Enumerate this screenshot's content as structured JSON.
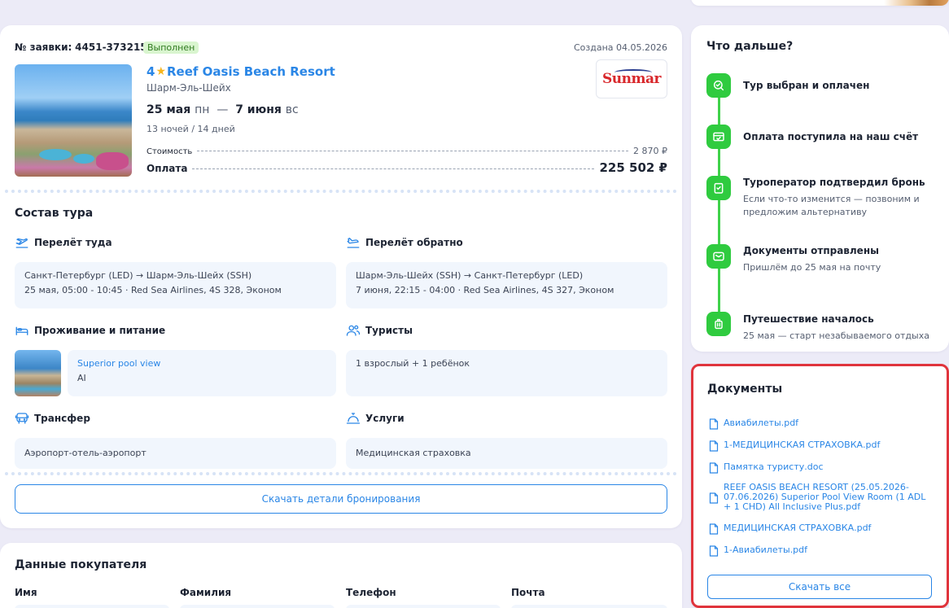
{
  "booking": {
    "order_label": "№ заявки:",
    "order_number": "4451-373215",
    "status": "Выполнен",
    "created": "Создана 04.05.2026",
    "hotel_stars": "4",
    "hotel_name": "Reef Oasis Beach Resort",
    "city": "Шарм-Эль-Шейх",
    "date_from": "25 мая",
    "dow_from": "пн",
    "dash": "—",
    "date_to": "7 июня",
    "dow_to": "вс",
    "nights": "13 ночей / 14 дней",
    "operator": "Sunmar",
    "cost_label": "Стоимость",
    "cost_value": "2 870 ₽",
    "pay_label": "Оплата",
    "pay_value": "225 502 ₽",
    "composition_title": "Состав тура",
    "flight_to": {
      "label": "Перелёт туда",
      "route": "Санкт-Петербург (LED) → Шарм-Эль-Шейх (SSH)",
      "details": "25 мая, 05:00 - 10:45 · Red Sea Airlines, 4S 328, Эконом"
    },
    "flight_back": {
      "label": "Перелёт обратно",
      "route": "Шарм-Эль-Шейх (SSH) → Санкт-Петербург (LED)",
      "details": "7 июня, 22:15 - 04:00 · Red Sea Airlines, 4S 327, Эконом"
    },
    "accommodation": {
      "label": "Проживание и питание",
      "room": "Superior pool view",
      "meal": "AI"
    },
    "tourists": {
      "label": "Туристы",
      "value": "1 взрослый + 1 ребёнок"
    },
    "transfer": {
      "label": "Трансфер",
      "value": "Аэропорт-отель-аэропорт"
    },
    "services": {
      "label": "Услуги",
      "value": "Медицинская страховка"
    },
    "download_label": "Скачать детали бронирования"
  },
  "buyer": {
    "title": "Данные покупателя",
    "columns": [
      "Имя",
      "Фамилия",
      "Телефон",
      "Почта"
    ]
  },
  "next": {
    "title": "Что дальше?",
    "steps": [
      {
        "title": "Тур выбран и оплачен",
        "desc": "",
        "icon": "search-check-icon"
      },
      {
        "title": "Оплата поступила на наш счёт",
        "desc": "",
        "icon": "wallet-icon"
      },
      {
        "title": "Туроператор подтвердил бронь",
        "desc": "Если что-то изменится — позвоним и предложим альтернативу",
        "icon": "clipboard-check-icon"
      },
      {
        "title": "Документы отправлены",
        "desc": "Пришлём до 25 мая на почту",
        "icon": "mail-icon"
      },
      {
        "title": "Путешествие началось",
        "desc": "25 мая — старт незабываемого отдыха",
        "icon": "luggage-icon"
      }
    ]
  },
  "documents": {
    "title": "Документы",
    "files": [
      "Авиабилеты.pdf",
      "1-МЕДИЦИНСКАЯ СТРАХОВКА.pdf",
      "Памятка туристу.doc",
      "REEF OASIS BEACH RESORT (25.05.2026-07.06.2026) Superior Pool View Room (1 ADL + 1 CHD) All Inclusive Plus.pdf",
      "МЕДИЦИНСКАЯ СТРАХОВКА.pdf",
      "1-Авиабилеты.pdf"
    ],
    "download_all": "Скачать все"
  },
  "colors": {
    "accent": "#2a86e6",
    "success": "#2fcb3f",
    "highlight_border": "#e0343c",
    "background": "#ecebf7"
  }
}
